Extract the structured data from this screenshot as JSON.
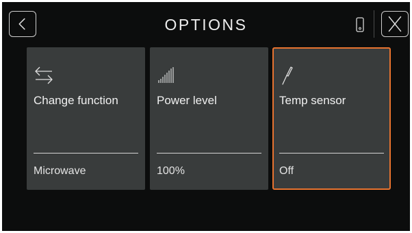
{
  "header": {
    "title": "OPTIONS",
    "back_icon": "chevron-left-icon",
    "device_icon": "phone-icon",
    "close_icon": "close-icon"
  },
  "cards": [
    {
      "label": "Change function",
      "value": "Microwave",
      "icon": "swap-arrows-icon",
      "selected": false
    },
    {
      "label": "Power level",
      "value": "100%",
      "icon": "power-bars-icon",
      "selected": false
    },
    {
      "label": "Temp sensor",
      "value": "Off",
      "icon": "temp-probe-icon",
      "selected": true
    }
  ],
  "colors": {
    "background": "#0c0d0d",
    "card": "#393c3c",
    "accent": "#e8732f",
    "text": "#f0f0f0"
  }
}
